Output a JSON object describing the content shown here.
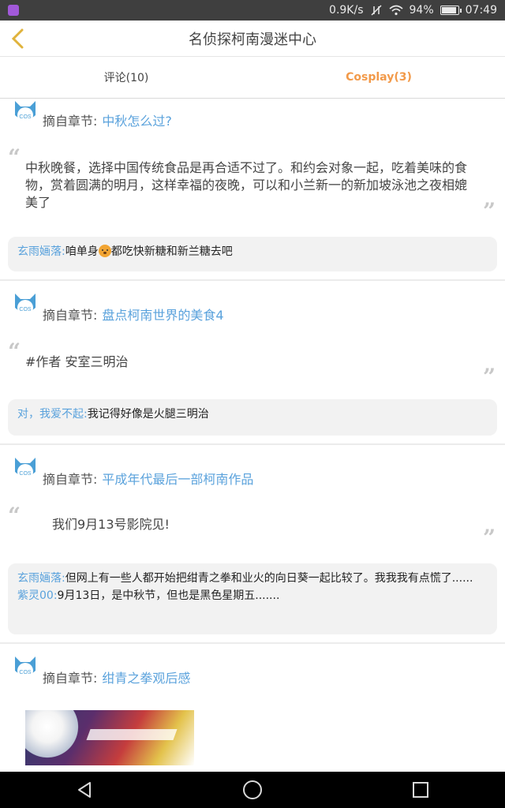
{
  "status_bar": {
    "network_speed": "0.9K/s",
    "battery_percent": "94%",
    "battery_level": 0.94,
    "time": "07:49",
    "icons": [
      "app-notification-icon",
      "mute-vibrate-icon",
      "wifi-icon",
      "battery-icon"
    ]
  },
  "header": {
    "back_icon": "chevron-left-icon",
    "title": "名侦探柯南漫迷中心"
  },
  "tabs": [
    {
      "label": "评论(10)",
      "active": false
    },
    {
      "label": "Cosplay(3)",
      "active": true
    }
  ],
  "colors": {
    "accent_orange": "#f29a4a",
    "link_blue": "#5aa2dc",
    "reply_bg": "#f2f2f2"
  },
  "posts": [
    {
      "chapter_prefix": "摘自章节:",
      "chapter_link": "中秋怎么过?",
      "body": "中秋晚餐，选择中国传统食品是再合适不过了。和约会对象一起，吃着美味的食物，赏着圆满的明月，这样幸福的夜晚，可以和小兰新一的新加坡泳池之夜相媲美了",
      "replies": [
        {
          "user": "玄雨婳落:",
          "text_before": "咱单身",
          "emoji": "dog-face-emoji",
          "text_after": "都吃快新糖和新兰糖去吧"
        }
      ]
    },
    {
      "chapter_prefix": "摘自章节:",
      "chapter_link": "盘点柯南世界的美食4",
      "body": "#作者 安室三明治",
      "replies": [
        {
          "user": "对，我爱不起:",
          "text": "我记得好像是火腿三明治"
        }
      ]
    },
    {
      "chapter_prefix": "摘自章节:",
      "chapter_link": "平成年代最后一部柯南作品",
      "body": "我们9月13号影院见!",
      "replies": [
        {
          "user": "玄雨婳落:",
          "text": "但网上有一些人都开始把绀青之拳和业火的向日葵一起比较了。我我我有点慌了......"
        },
        {
          "user": "紫灵00:",
          "text": "9月13日，是中秋节，但也是黑色星期五......."
        }
      ]
    },
    {
      "chapter_prefix": "摘自章节:",
      "chapter_link": "绀青之拳观后感",
      "image": "movie-poster-thumbnail"
    }
  ],
  "nav": {
    "back": "triangle-back-icon",
    "home": "circle-home-icon",
    "recents": "square-recents-icon"
  }
}
